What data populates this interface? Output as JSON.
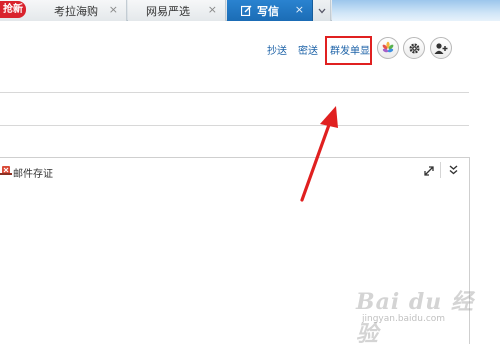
{
  "tabs": [
    {
      "badge": "抢新",
      "label": "考拉海购",
      "close": "×"
    },
    {
      "label": "网易严选",
      "close": "×"
    },
    {
      "label": "写信",
      "close": "×",
      "active": true
    }
  ],
  "tab_more_icon": "chevron-down-icon",
  "header": {
    "cc_label": "抄送",
    "bcc_label": "密送",
    "mass_send_label": "群发单显",
    "icons": [
      "color-petal-icon",
      "gear-icon",
      "add-contact-icon"
    ]
  },
  "editor": {
    "doc_label": "邮件存证"
  },
  "annotation": {
    "highlight_color": "#e02020"
  },
  "watermark": {
    "main": "Bai du 经验",
    "sub": "jingyan.baidu.com"
  }
}
